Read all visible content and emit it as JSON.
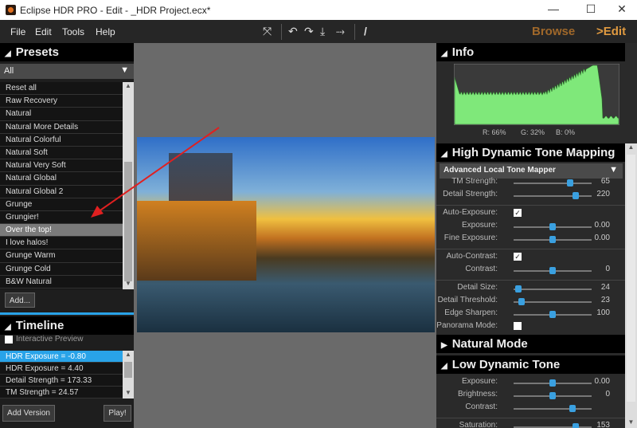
{
  "window": {
    "title": "Eclipse HDR PRO - Edit - _HDR Project.ecx*",
    "minimize": "—",
    "maximize": "☐",
    "close": "✕"
  },
  "menu": [
    "File",
    "Edit",
    "Tools",
    "Help"
  ],
  "toolbar": {
    "icons": [
      "fit-screen",
      "rotate-left",
      "rotate-right",
      "flip-vertical",
      "flip-horizontal",
      "brush"
    ],
    "glyphs": [
      "⤧",
      "↶",
      "↷",
      "⤓",
      "⤑",
      "/"
    ],
    "browse": "Browse",
    "edit": ">Edit"
  },
  "presets": {
    "title": "Presets",
    "filter": "All",
    "items": [
      "Reset all",
      "Raw Recovery",
      "Natural",
      "Natural More Details",
      "Natural Colorful",
      "Natural Soft",
      "Natural Very Soft",
      "Natural Global",
      "Natural Global 2",
      "Grunge",
      "Grungier!",
      "Over the top!",
      "I love halos!",
      "Grunge Warm",
      "Grunge Cold",
      "B&W Natural"
    ],
    "selected": "Over the top!",
    "add": "Add..."
  },
  "timeline": {
    "title": "Timeline",
    "interactive_preview": "Interactive Preview",
    "interactive_checked": false,
    "items": [
      "HDR Exposure = -0.80",
      "HDR Exposure = 4.40",
      "Detail Strength = 173.33",
      "TM Strength = 24.57"
    ],
    "selected": "HDR Exposure = -0.80",
    "add_version": "Add Version",
    "play": "Play!"
  },
  "info": {
    "title": "Info",
    "r": "R: 66%",
    "g": "G: 32%",
    "b": "B: 0%",
    "histogram_color": "#7fe87a"
  },
  "hdtm": {
    "title": "High Dynamic Tone Mapping",
    "mapper": "Advanced Local Tone Mapper",
    "rows": [
      {
        "label": "TM Strength:",
        "value": "65",
        "pos": 0.72
      },
      {
        "label": "Detail Strength:",
        "value": "220",
        "pos": 0.8
      },
      {
        "label": "Auto-Exposure:",
        "check": true
      },
      {
        "label": "Exposure:",
        "value": "0.00",
        "pos": 0.5
      },
      {
        "label": "Fine Exposure:",
        "value": "0.00",
        "pos": 0.5
      },
      {
        "label": "Auto-Contrast:",
        "check": true
      },
      {
        "label": "Contrast:",
        "value": "0",
        "pos": 0.5
      },
      {
        "label": "Detail Size:",
        "value": "24",
        "pos": 0.06
      },
      {
        "label": "Detail Threshold:",
        "value": "23",
        "pos": 0.1
      },
      {
        "label": "Edge Sharpen:",
        "value": "100",
        "pos": 0.5
      },
      {
        "label": "Panorama Mode:",
        "check": false
      }
    ]
  },
  "natural": {
    "title": "Natural Mode"
  },
  "ldt": {
    "title": "Low Dynamic Tone",
    "rows": [
      {
        "label": "Exposure:",
        "value": "0.00",
        "pos": 0.5
      },
      {
        "label": "Brightness:",
        "value": "0",
        "pos": 0.5
      },
      {
        "label": "Contrast:",
        "value": "",
        "pos": 0.75
      },
      {
        "label": "Saturation:",
        "value": "153",
        "pos": 0.8
      }
    ]
  },
  "accent": "#29a3e8"
}
